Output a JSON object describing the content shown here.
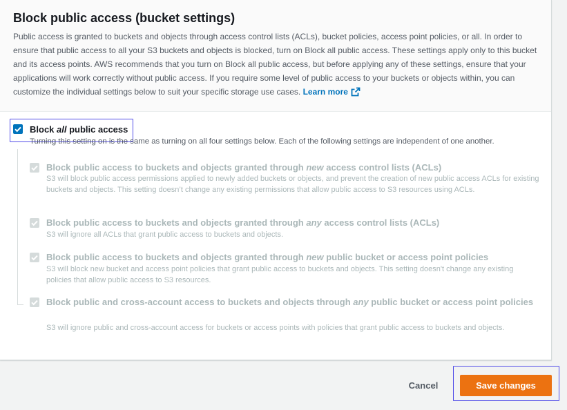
{
  "panel": {
    "title": "Block public access (bucket settings)",
    "description": "Public access is granted to buckets and objects through access control lists (ACLs), bucket policies, access point policies, or all. In order to ensure that public access to all your S3 buckets and objects is blocked, turn on Block all public access. These settings apply only to this bucket and its access points. AWS recommends that you turn on Block all public access, but before applying any of these settings, ensure that your applications will work correctly without public access. If you require some level of public access to your buckets or objects within, you can customize the individual settings below to suit your specific storage use cases.",
    "learn_more": "Learn more",
    "learn_more_icon": "external-link-icon"
  },
  "block_all": {
    "checked": true,
    "label_before": "Block ",
    "label_em": "all",
    "label_after": " public access",
    "description": "Turning this setting on is the same as turning on all four settings below. Each of the following settings are independent of one another."
  },
  "settings": [
    {
      "checked": true,
      "label_before": "Block public access to buckets and objects granted through ",
      "label_em": "new",
      "label_after": " access control lists (ACLs)",
      "description": "S3 will block public access permissions applied to newly added buckets or objects, and prevent the creation of new public access ACLs for existing buckets and objects. This setting doesn’t change any existing permissions that allow public access to S3 resources using ACLs."
    },
    {
      "checked": true,
      "label_before": "Block public access to buckets and objects granted through ",
      "label_em": "any",
      "label_after": " access control lists (ACLs)",
      "description": "S3 will ignore all ACLs that grant public access to buckets and objects."
    },
    {
      "checked": true,
      "label_before": "Block public access to buckets and objects granted through ",
      "label_em": "new",
      "label_after": " public bucket or access point policies",
      "description": "S3 will block new bucket and access point policies that grant public access to buckets and objects. This setting doesn't change any existing policies that allow public access to S3 resources."
    },
    {
      "checked": true,
      "label_before": "Block public and cross-account access to buckets and objects through ",
      "label_em": "any",
      "label_after": " public bucket or access point policies",
      "description": "S3 will ignore public and cross-account access for buckets or access points with policies that grant public access to buckets and objects."
    }
  ],
  "footer": {
    "cancel_label": "Cancel",
    "save_label": "Save changes"
  },
  "colors": {
    "accent": "#0073bb",
    "primary_button": "#ec7211",
    "disabled": "#aab7b8",
    "focus": "#4f4ae8"
  }
}
